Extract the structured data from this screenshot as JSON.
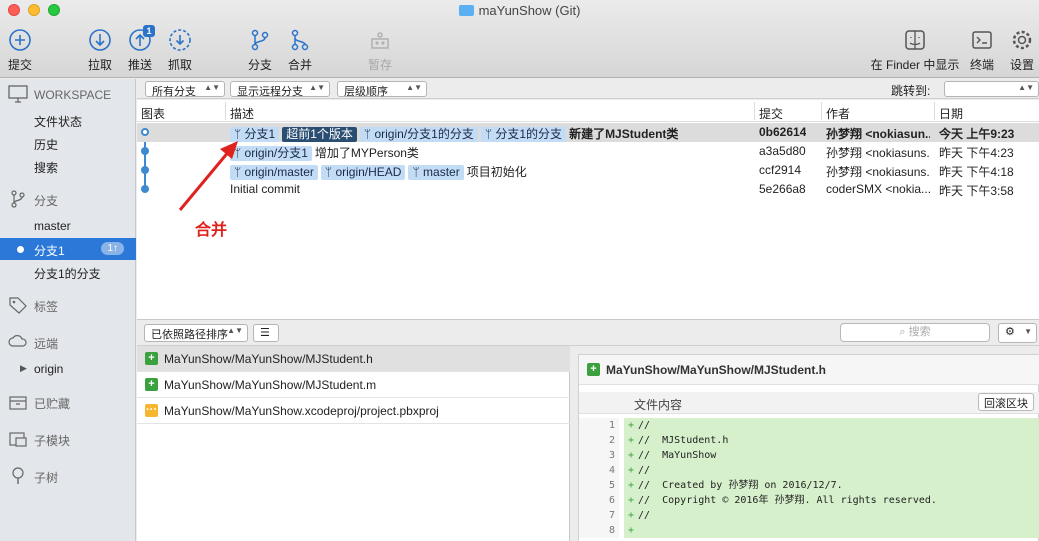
{
  "window": {
    "title": "maYunShow (Git)"
  },
  "toolbar": {
    "commit": "提交",
    "pull": "拉取",
    "push": "推送",
    "push_badge": "1",
    "fetch": "抓取",
    "branch": "分支",
    "merge": "合并",
    "stash": "暂存",
    "finder": "在 Finder 中显示",
    "terminal": "终端",
    "settings": "设置"
  },
  "sidebar": {
    "workspace": "WORKSPACE",
    "file_status": "文件状态",
    "history": "历史",
    "search": "搜索",
    "branches": "分支",
    "branch_items": [
      "master",
      "分支1",
      "分支1的分支"
    ],
    "active_branch_count": "1↑",
    "tags": "标签",
    "remotes": "远端",
    "remote_origin": "origin",
    "stashes": "已贮藏",
    "submodules": "子模块",
    "subtrees": "子树"
  },
  "filters": {
    "all_branches": "所有分支",
    "show_remote": "显示远程分支",
    "order": "层级顺序",
    "jump_to": "跳转到:"
  },
  "commit_table": {
    "headers": {
      "graph": "图表",
      "description": "描述",
      "commit": "提交",
      "author": "作者",
      "date": "日期"
    },
    "rows": [
      {
        "refs": [
          "分支1",
          "超前1个版本",
          "origin/分支1的分支",
          "分支1的分支"
        ],
        "message": "新建了MJStudent类",
        "hash": "0b62614",
        "author": "孙梦翔 <nokiasun...",
        "date": "今天 上午9:23"
      },
      {
        "refs": [
          "origin/分支1"
        ],
        "message": "增加了MYPerson类",
        "hash": "a3a5d80",
        "author": "孙梦翔 <nokiasuns...",
        "date": "昨天 下午4:23"
      },
      {
        "refs": [
          "origin/master",
          "origin/HEAD",
          "master"
        ],
        "message": "项目初始化",
        "hash": "ccf2914",
        "author": "孙梦翔 <nokiasuns...",
        "date": "昨天 下午4:18"
      },
      {
        "refs": [],
        "message": "Initial commit",
        "hash": "5e266a8",
        "author": "coderSMX <nokia...",
        "date": "昨天 下午3:58"
      }
    ]
  },
  "annotation": {
    "text": "合并",
    "color": "#e0221e"
  },
  "lower_toolbar": {
    "sort": "已依照路径排序",
    "search_placeholder": "搜索"
  },
  "files": [
    {
      "status": "added",
      "path": "MaYunShow/MaYunShow/MJStudent.h"
    },
    {
      "status": "added",
      "path": "MaYunShow/MaYunShow/MJStudent.m"
    },
    {
      "status": "modified",
      "path": "MaYunShow/MaYunShow.xcodeproj/project.pbxproj"
    }
  ],
  "diff": {
    "file": "MaYunShow/MaYunShow/MJStudent.h",
    "hunk_title": "文件内容",
    "hunk_button": "回滚区块",
    "lines": [
      {
        "n": "1",
        "text": "//"
      },
      {
        "n": "2",
        "text": "//  MJStudent.h"
      },
      {
        "n": "3",
        "text": "//  MaYunShow"
      },
      {
        "n": "4",
        "text": "//"
      },
      {
        "n": "5",
        "text": "//  Created by 孙梦翔 on 2016/12/7."
      },
      {
        "n": "6",
        "text": "//  Copyright © 2016年 孙梦翔. All rights reserved."
      },
      {
        "n": "7",
        "text": "//"
      },
      {
        "n": "8",
        "text": ""
      }
    ]
  },
  "colors": {
    "accent": "#2b78d8",
    "ref_bg": "#c3dcf5",
    "added": "#3ba03e",
    "modified": "#f5b730",
    "diff_add_bg": "#d6f0cc"
  }
}
